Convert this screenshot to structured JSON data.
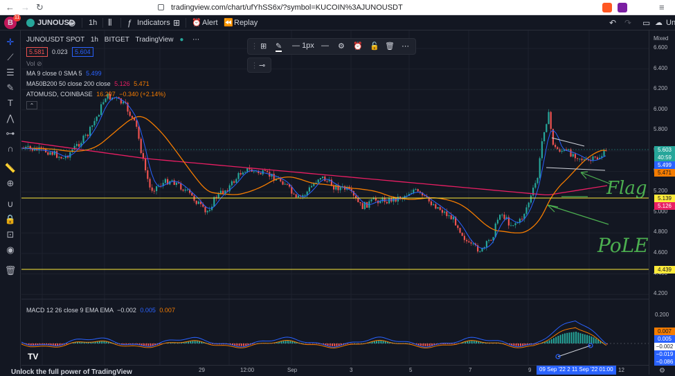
{
  "browser": {
    "url": "tradingview.com/chart/ufYhSS6x/?symbol=KUCOIN%3AJUNOUSDT",
    "profile_badge": "11"
  },
  "topbar": {
    "symbol": "JUNOUSD",
    "interval": "1h",
    "indicators_label": "Indicators",
    "alert_label": "Alert",
    "replay_label": "Replay",
    "unnamed_label": "Un"
  },
  "legend": {
    "title": "JUNOUSDT SPOT",
    "interval": "1h",
    "exchange": "BITGET",
    "source": "TradingView",
    "bid": "5.581",
    "spread": "0.023",
    "ask": "5.604",
    "vol_label": "Vol",
    "ma9": {
      "label": "MA 9 close 0 SMA 5",
      "value": "5.499"
    },
    "ma50": {
      "label": "MA50B200 50 close 200 close",
      "value1": "5.126",
      "value2": "5.471"
    },
    "atom": {
      "label": "ATOMUSD, COINBASE",
      "value": "16.207",
      "change": "−0.340 (+2.14%)"
    }
  },
  "drawing_toolbar": {
    "width_label": "1px"
  },
  "price_scale": {
    "mode": "Mixed",
    "ticks": [
      "6.600",
      "6.400",
      "6.200",
      "6.000",
      "5.800",
      "5.600",
      "5.400",
      "5.200",
      "5.000",
      "4.800",
      "4.600",
      "4.400",
      "4.200"
    ],
    "labels": {
      "last": "5.603",
      "countdown": "40:59",
      "ma": "5.499",
      "ma200": "5.471",
      "hline1": "5.139",
      "ma50": "5.126",
      "hline2": "4.439"
    }
  },
  "macd": {
    "label": "MACD 12 26 close 9 EMA EMA",
    "hist": "−0.002",
    "macd_val": "0.005",
    "signal_val": "0.007",
    "ticks": [
      "0.200",
      "0.007",
      "0.005",
      "−0.002",
      "−0.019",
      "−0.086"
    ]
  },
  "time_axis": {
    "ticks": [
      "29",
      "12:00",
      "Sep",
      "3",
      "5",
      "7",
      "9",
      "12"
    ],
    "range_label": "09 Sep '22   2   11 Sep '22   01:00"
  },
  "annotations": {
    "flag": "Flag",
    "pole": "PoLE"
  },
  "footer": {
    "unlock": "Unlock the full power of TradingView"
  },
  "colors": {
    "bg": "#131722",
    "up": "#26a69a",
    "down": "#ef5350",
    "ma9": "#2962ff",
    "ma50": "#f57c00",
    "ma200": "#e91e63",
    "hline": "#ffeb3b",
    "annotation": "#4caf50"
  }
}
